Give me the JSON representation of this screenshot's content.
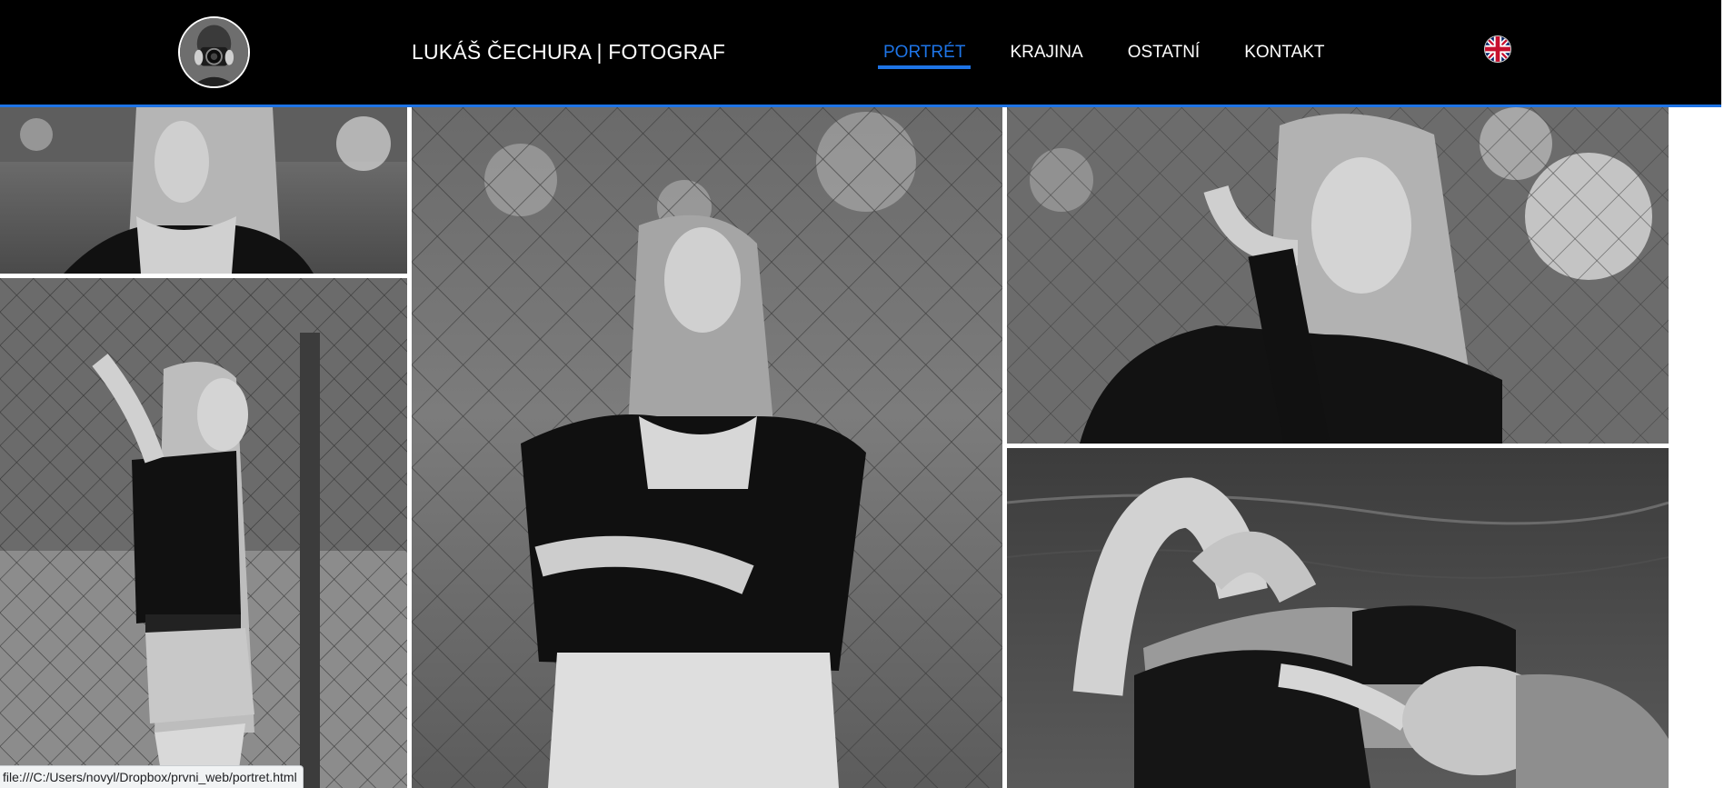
{
  "header": {
    "title": "LUKÁŠ ČECHURA | FOTOGRAF",
    "avatar_icon": "photographer-avatar-icon",
    "accent_color": "#1e74e6",
    "background_color": "#000000"
  },
  "nav": {
    "items": [
      {
        "label": "PORTRÉT",
        "active": true
      },
      {
        "label": "KRAJINA",
        "active": false
      },
      {
        "label": "OSTATNÍ",
        "active": false
      },
      {
        "label": "KONTAKT",
        "active": false
      }
    ],
    "language_icon": "uk-flag-icon"
  },
  "gallery": {
    "photos": [
      {
        "name": "portrait-photo-closeup-left"
      },
      {
        "name": "portrait-photo-standing-fence"
      },
      {
        "name": "portrait-photo-sitting-center"
      },
      {
        "name": "portrait-photo-hand-in-hair"
      },
      {
        "name": "portrait-photo-lying-grass"
      }
    ]
  },
  "status_bar": {
    "url": "file:///C:/Users/novyl/Dropbox/prvni_web/portret.html"
  }
}
